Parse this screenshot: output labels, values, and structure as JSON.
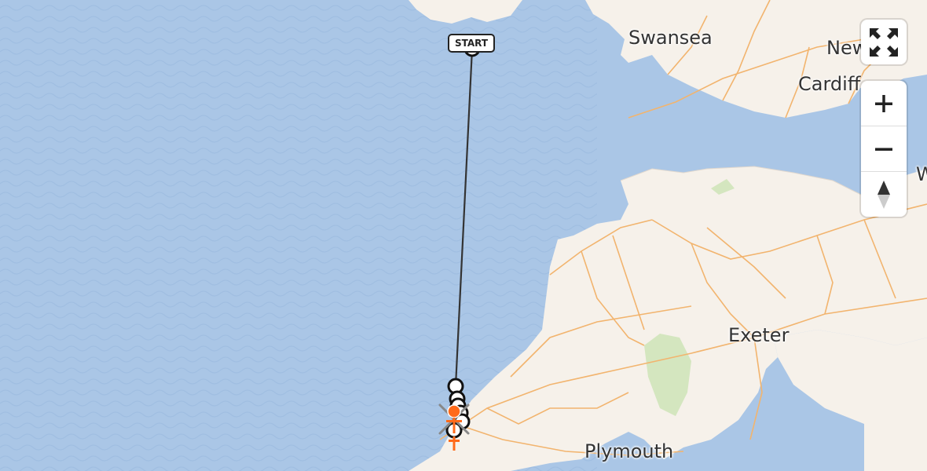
{
  "map": {
    "cities": [
      {
        "id": "swansea",
        "name": "Swansea"
      },
      {
        "id": "newport",
        "name": "Newport"
      },
      {
        "id": "cardiff",
        "name": "Cardiff"
      },
      {
        "id": "exeter",
        "name": "Exeter"
      },
      {
        "id": "plymouth",
        "name": "Plymouth"
      },
      {
        "id": "partial-w",
        "name": "W"
      }
    ],
    "route": {
      "start_label": "START",
      "line_color": "#333333",
      "marker_color": "#ffffff",
      "end_marker_color": "#ff6a1a"
    },
    "colors": {
      "sea": "#aac6e6",
      "land": "#f6f1ea",
      "roads": "#f2b46e",
      "parks": "#d4e6bf"
    }
  },
  "controls": {
    "fullscreen": {
      "icon": "fullscreen-icon"
    },
    "zoom_in": {
      "icon": "plus-icon"
    },
    "zoom_out": {
      "icon": "minus-icon"
    },
    "compass": {
      "icon": "compass-icon"
    }
  }
}
